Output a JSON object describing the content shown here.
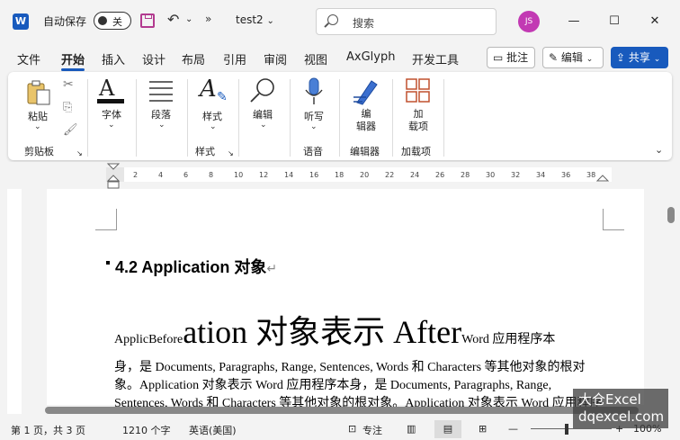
{
  "titlebar": {
    "autosave_label": "自动保存",
    "autosave_state": "关",
    "more": "»",
    "doc_title": "test2",
    "search_placeholder": "搜索",
    "avatar_initials": "JS",
    "min": "—",
    "max": "☐",
    "close": "✕"
  },
  "tabs": [
    "文件",
    "开始",
    "插入",
    "设计",
    "布局",
    "引用",
    "审阅",
    "视图",
    "AxGlyph",
    "开发工具"
  ],
  "active_tab": "开始",
  "right_buttons": {
    "comment": "批注",
    "edit": "编辑",
    "share": "共享"
  },
  "ribbon": {
    "buttons": {
      "paste": "粘贴",
      "font": "字体",
      "paragraph": "段落",
      "styles": "样式",
      "editing": "编辑",
      "dictate": "听写",
      "editor": "编\n辑器",
      "addins": "加\n载项"
    },
    "groups": {
      "clipboard": "剪贴板",
      "styles": "样式",
      "voice": "语音",
      "editor": "编辑器",
      "addins": "加载项"
    }
  },
  "ruler_ticks": [
    "2",
    "4",
    "6",
    "8",
    "10",
    "12",
    "14",
    "16",
    "18",
    "20",
    "22",
    "24",
    "26",
    "28",
    "30",
    "32",
    "34",
    "36",
    "38"
  ],
  "document": {
    "heading": "4.2 Application  对象",
    "line1_small": "ApplicBefore",
    "line1_big": "ation 对象表示 After",
    "line1_tail": "Word 应用程序本",
    "line2": "身，是 Documents, Paragraphs, Range, Sentences, Words 和 Characters 等其他对象的根对",
    "line3": "象。Application 对象表示 Word 应用程序本身，是 Documents, Paragraphs, Range,",
    "line4": "Sentences, Words 和 Characters 等其他对象的根对象。Application 对象表示 Word 应用程序"
  },
  "statusbar": {
    "page": "第 1 页，共 3 页",
    "words": "1210 个字",
    "language": "英语(美国)",
    "focus": "专注",
    "zoom": "100%"
  },
  "watermark": {
    "line1": "大仓Excel",
    "line2": "dqexcel.com"
  },
  "colors": {
    "accent": "#185abd",
    "save_icon": "#b23a8f",
    "avatar": "#c239b3"
  }
}
